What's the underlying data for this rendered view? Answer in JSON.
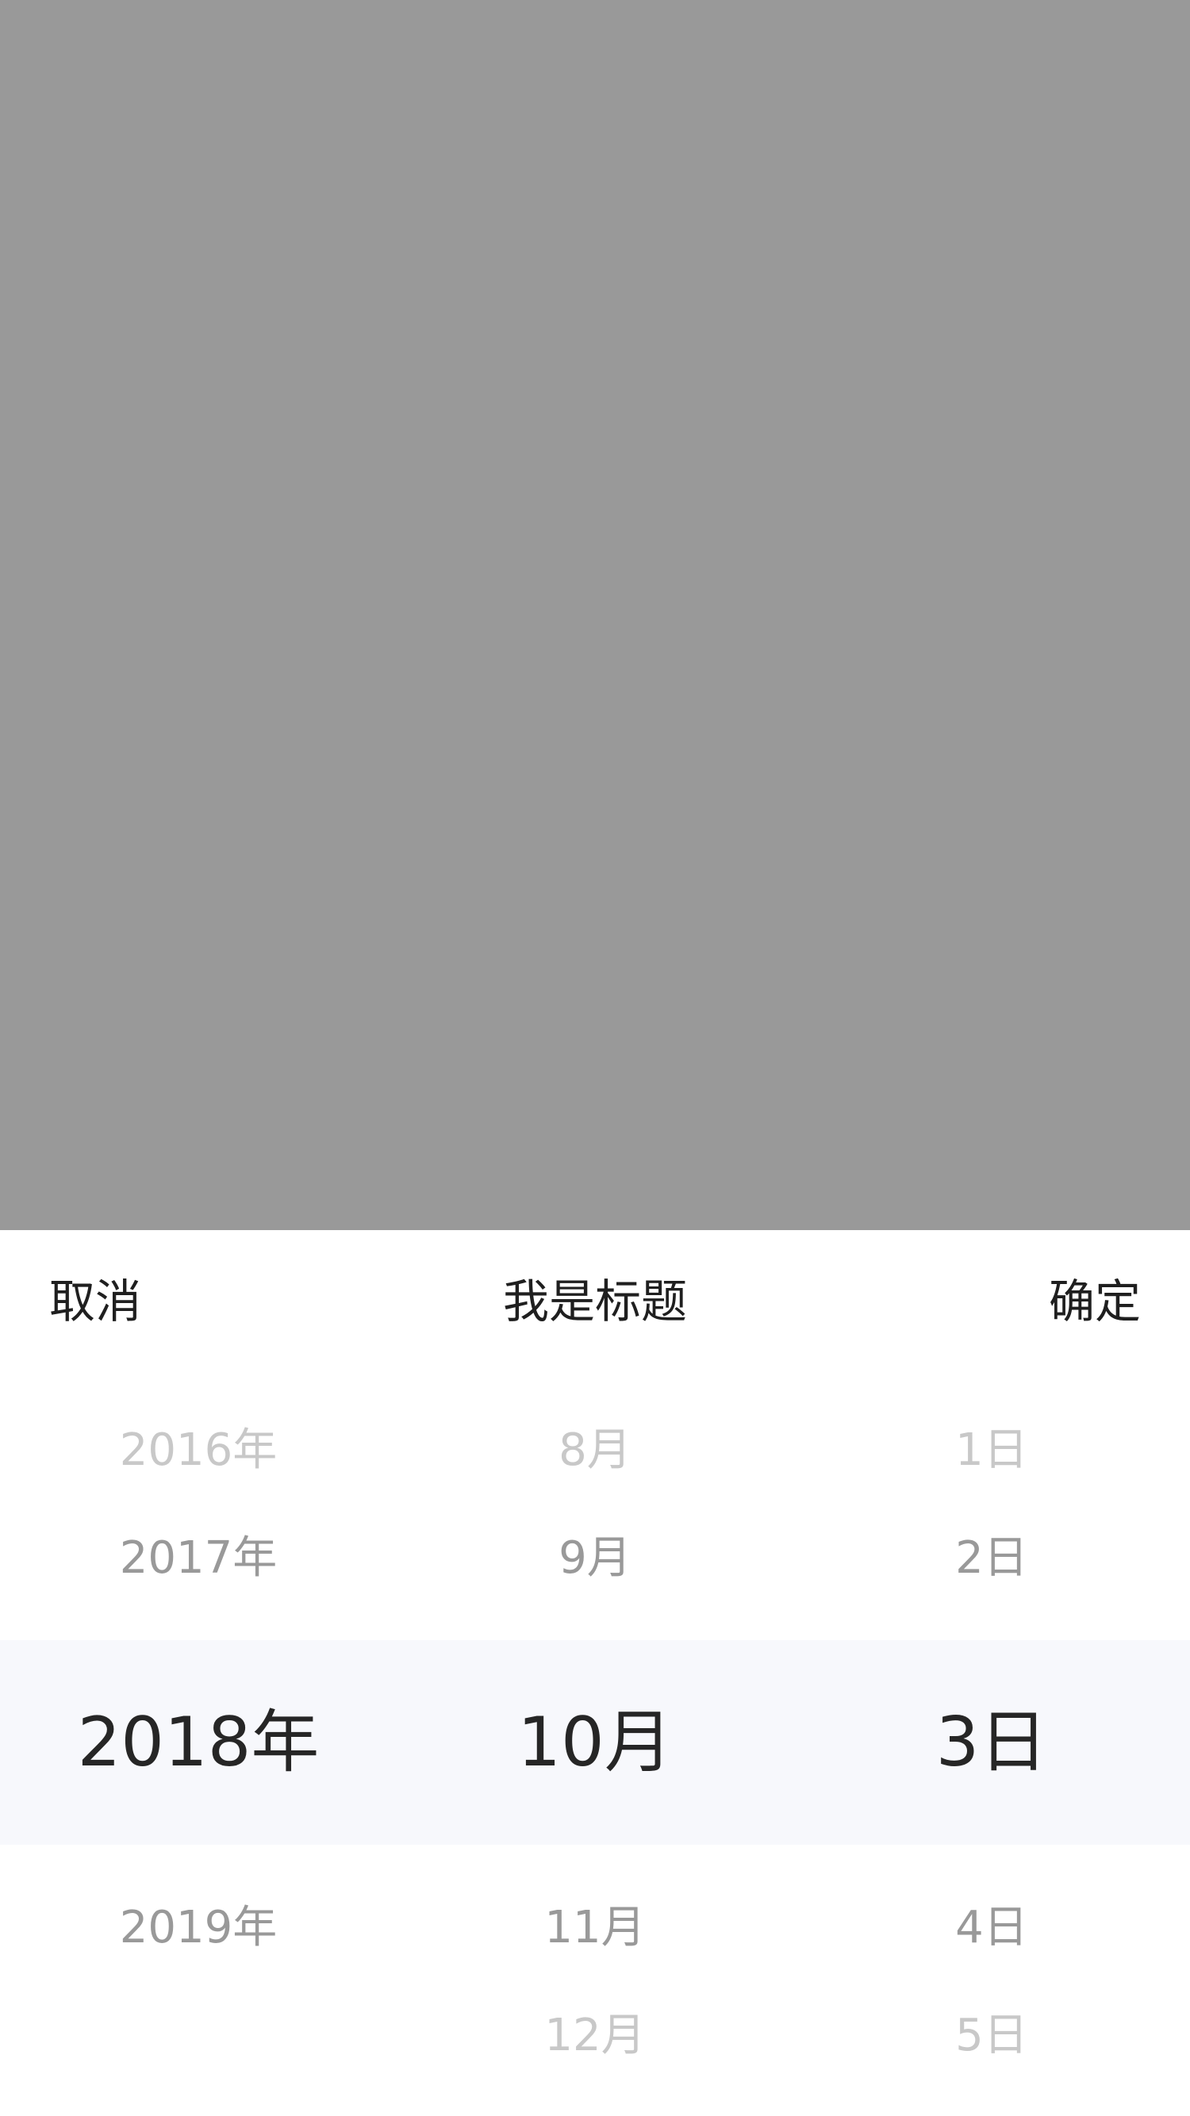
{
  "toolbar": {
    "cancel_label": "取消",
    "title": "我是标题",
    "confirm_label": "确定"
  },
  "picker": {
    "years": [
      "2016年",
      "2017年",
      "2018年",
      "2019年"
    ],
    "months": [
      "8月",
      "9月",
      "10月",
      "11月",
      "12月"
    ],
    "days": [
      "1日",
      "2日",
      "3日",
      "4日",
      "5日"
    ],
    "selected": {
      "year": "2018年",
      "month": "10月",
      "day": "3日"
    }
  },
  "colors": {
    "overlay": "#999999",
    "highlight_band": "#f7f8fc",
    "selected_text": "#262626",
    "near_text": "#999999",
    "far_text": "#c8c8c8"
  }
}
